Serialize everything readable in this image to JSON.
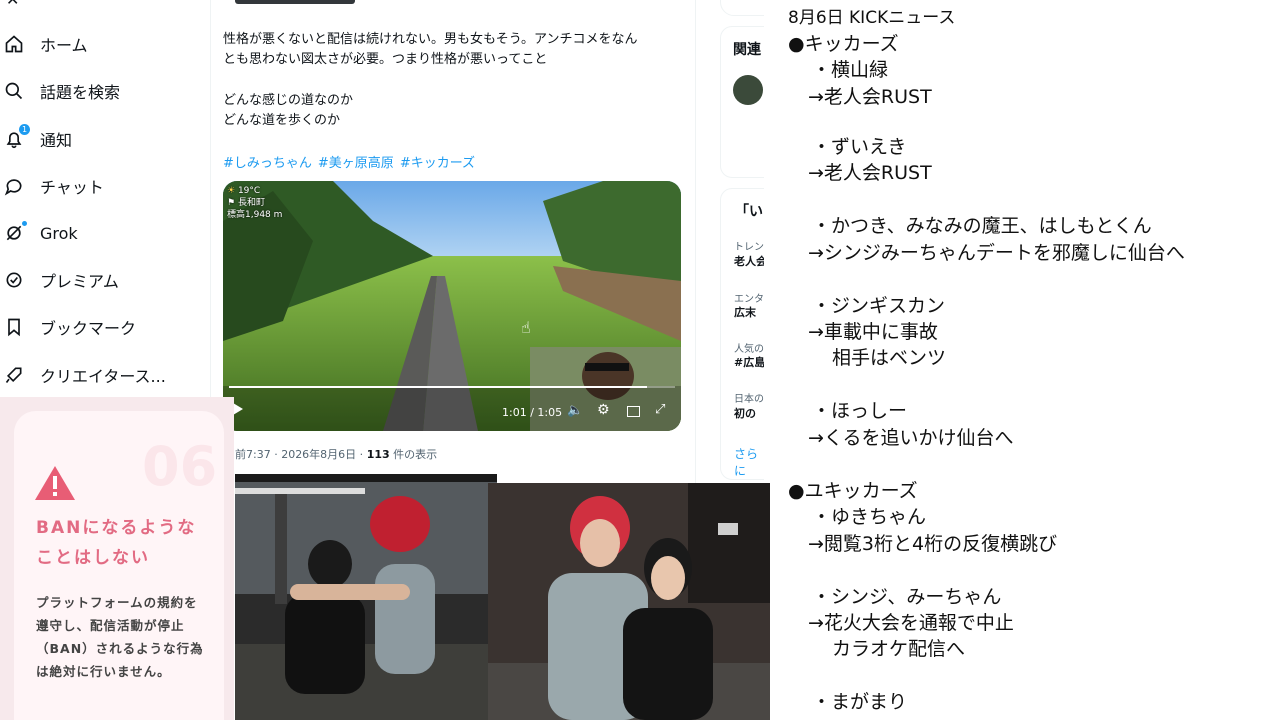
{
  "sidebar": {
    "items": [
      {
        "label": "ホーム",
        "icon": "home-icon"
      },
      {
        "label": "話題を検索",
        "icon": "search-icon"
      },
      {
        "label": "通知",
        "icon": "bell-icon",
        "badge": "1"
      },
      {
        "label": "チャット",
        "icon": "chat-icon"
      },
      {
        "label": "Grok",
        "icon": "grok-icon"
      },
      {
        "label": "プレミアム",
        "icon": "premium-icon"
      },
      {
        "label": "ブックマーク",
        "icon": "bookmark-icon"
      },
      {
        "label": "クリエイタース...",
        "icon": "rocket-icon"
      }
    ]
  },
  "tweet": {
    "line1": "性格が悪くないと配信は続けれない。男も女もそう。アンチコメをなん",
    "line2": "とも思わない図太さが必要。つまり性格が悪いってこと",
    "line3": "どんな感じの道なのか",
    "line4": "どんな道を歩くのか",
    "hashtags": [
      "#しみっちゃん",
      "#美ヶ原高原",
      "#キッカーズ"
    ],
    "video": {
      "temp": "19°C",
      "location": "長和町",
      "altitude": "標高1,948 m",
      "time": "1:01 / 1:05",
      "progress": 0.938
    },
    "meta_time": "前7:37 · 2026年8月6日 · ",
    "views_count": "113",
    "views_label": " 件の表示"
  },
  "right": {
    "related_title": "関連",
    "trend_title": "「い",
    "trend1_small": "トレン",
    "trend1_bold": "老人会",
    "trend2_small": "エンタ",
    "trend2_bold": "広末",
    "trend3_small": "人気の",
    "trend3_bold": "#広島",
    "trend4_small": "日本の",
    "trend4_bold": "初の",
    "more": "さらに"
  },
  "news": {
    "lines": [
      "8月6日 KICKニュース",
      "●キッカーズ",
      "・横山緑",
      "→老人会RUST",
      "",
      "・ずいえき",
      "→老人会RUST",
      "",
      "・かつき、みなみの魔王、はしもとくん",
      "→シンジみーちゃんデートを邪魔しに仙台へ",
      "",
      "・ジンギスカン",
      "→車載中に事故",
      "相手はベンツ",
      "",
      "・ほっしー",
      "→くるを追いかけ仙台へ",
      "",
      "●ユキッカーズ",
      "・ゆきちゃん",
      "→閲覧3桁と4桁の反復横跳び",
      "",
      "・シンジ、みーちゃん",
      "→花火大会を通報で中止",
      "カラオケ配信へ",
      "",
      "・まがまり"
    ]
  },
  "ban": {
    "number": "06",
    "title1": "BANになるような",
    "title2": "ことはしない",
    "body": "プラットフォームの規約を遵守し、配信活動が停止（BAN）されるような行為は絶対に行いません。"
  },
  "colors": {
    "accent": "#1d9bf0",
    "ban_pink": "#e26b83",
    "warning": "#e85d75"
  }
}
